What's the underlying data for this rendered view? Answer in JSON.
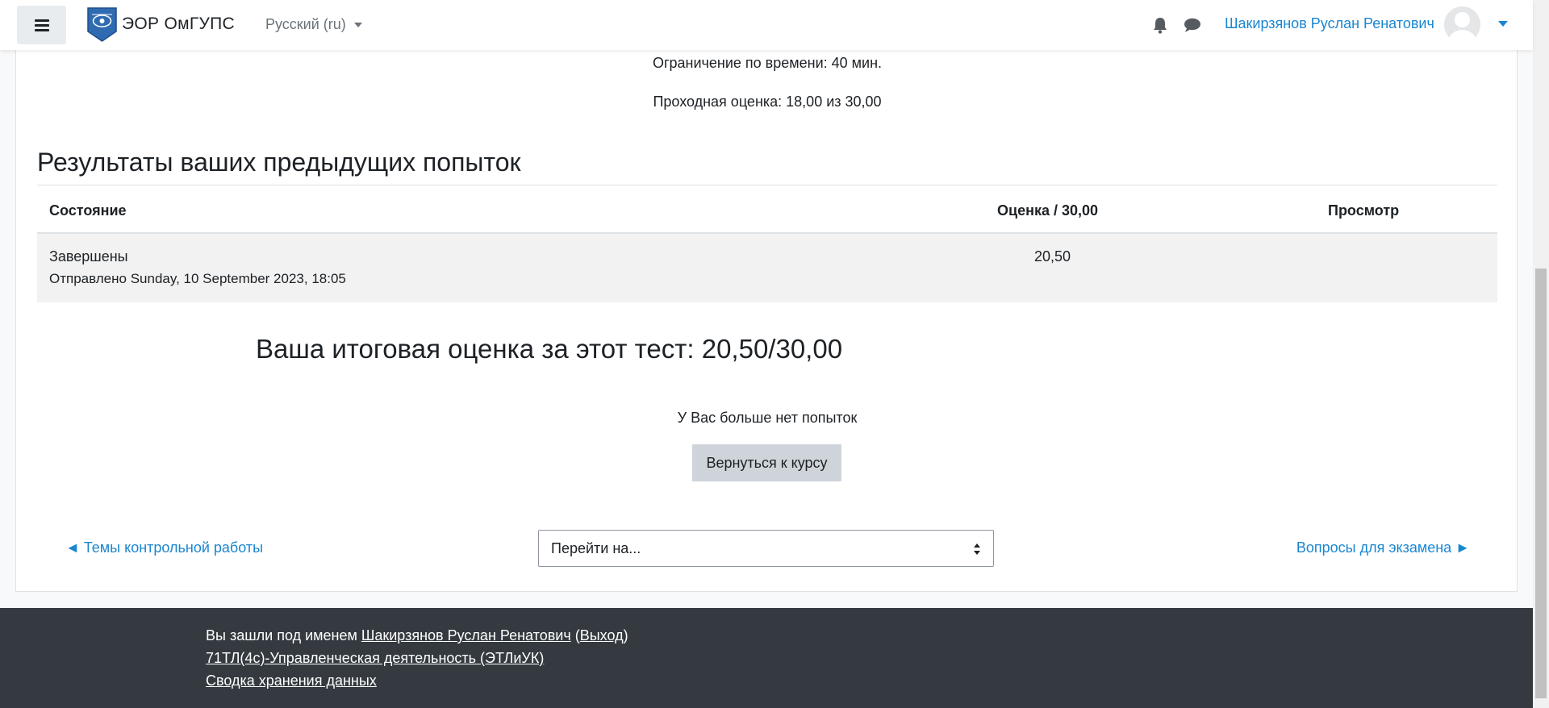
{
  "navbar": {
    "brand_name": "ЭОР ОмГУПС",
    "language": "Русский (ru)",
    "user_name": "Шакирзянов Руслан Ренатович",
    "accent_color": "#1a86d0"
  },
  "quiz_info": {
    "time_limit": "Ограничение по времени: 40 мин.",
    "pass_grade": "Проходная оценка: 18,00 из 30,00"
  },
  "attempts": {
    "title": "Результаты ваших предыдущих попыток",
    "columns": [
      "Состояние",
      "Оценка / 30,00",
      "Просмотр"
    ],
    "rows": [
      {
        "state": "Завершены",
        "submitted": "Отправлено Sunday, 10 September 2023, 18:05",
        "grade": "20,50",
        "review": ""
      }
    ]
  },
  "summary": {
    "final_grade": "Ваша итоговая оценка за этот тест: 20,50/30,00",
    "no_attempts": "У Вас больше нет попыток",
    "back_button": "Вернуться к курсу"
  },
  "activity_nav": {
    "prev": "◄ Темы контрольной работы",
    "jump_placeholder": "Перейти на...",
    "next": "Вопросы для экзамена ►"
  },
  "footer": {
    "logged_in_prefix": "Вы зашли под именем",
    "user_name": "Шакирзянов Руслан Ренатович",
    "logout_open": "(",
    "logout": "Выход",
    "logout_close": ")",
    "course": "71ТЛ(4с)-Управленческая деятельность (ЭТЛиУК)",
    "data_retention": "Сводка хранения данных"
  },
  "icons": {
    "menu": "hamburger-icon",
    "notifications": "bell-icon",
    "messages": "chat-icon",
    "avatar": "user-avatar-icon",
    "select": "select-arrows-icon"
  }
}
